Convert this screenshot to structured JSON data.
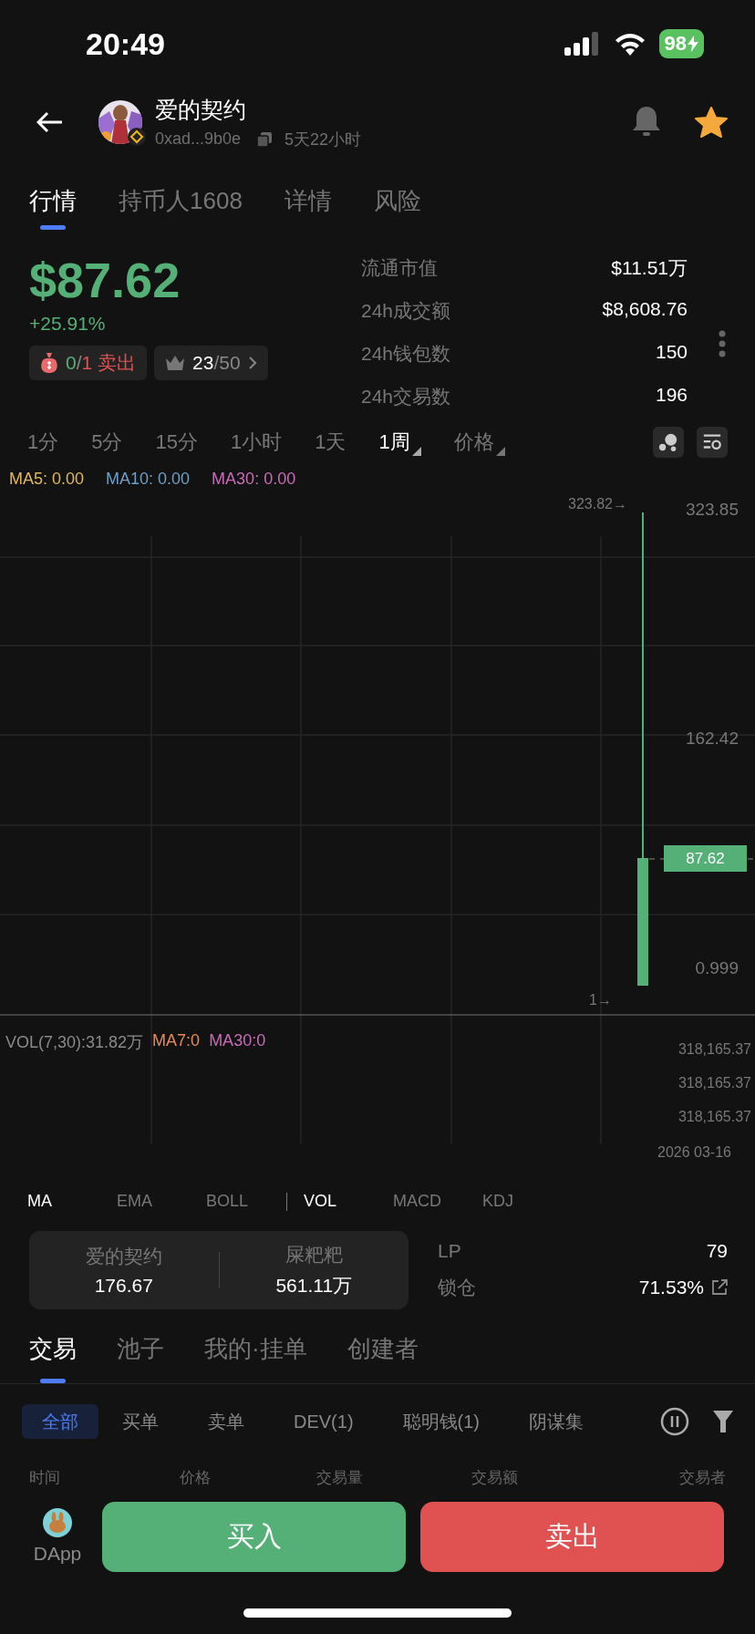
{
  "status_bar": {
    "time": "20:49",
    "battery": "98"
  },
  "header": {
    "title": "爱的契约",
    "address": "0xad...9b0e",
    "age": "5天22小时",
    "starred": true
  },
  "tabs": [
    {
      "label": "行情",
      "selected": true
    },
    {
      "label": "持币人1608",
      "selected": false
    },
    {
      "label": "详情",
      "selected": false
    },
    {
      "label": "风险",
      "selected": false
    }
  ],
  "price": {
    "value": "$87.62",
    "change": "+25.91%"
  },
  "sell_badge": {
    "buys": "0",
    "sep": "/",
    "sells": "1",
    "label": "卖出"
  },
  "top_badge": {
    "rank": "23",
    "total": "/50"
  },
  "stats": [
    {
      "label": "流通市值",
      "value": "$11.51万"
    },
    {
      "label": "24h成交额",
      "value": "$8,608.76"
    },
    {
      "label": "24h钱包数",
      "value": "150"
    },
    {
      "label": "24h交易数",
      "value": "196"
    }
  ],
  "intervals": [
    {
      "label": "1分",
      "selected": false,
      "dropdown": false
    },
    {
      "label": "5分",
      "selected": false,
      "dropdown": false
    },
    {
      "label": "15分",
      "selected": false,
      "dropdown": false
    },
    {
      "label": "1小时",
      "selected": false,
      "dropdown": false
    },
    {
      "label": "1天",
      "selected": false,
      "dropdown": false
    },
    {
      "label": "1周",
      "selected": true,
      "dropdown": true
    },
    {
      "label": "价格",
      "selected": false,
      "dropdown": true
    }
  ],
  "ma_legend": [
    {
      "label": "MA5: 0.00",
      "color": "#e0b85a"
    },
    {
      "label": "MA10: 0.00",
      "color": "#6e9fc8"
    },
    {
      "label": "MA30: 0.00",
      "color": "#c86bb8"
    }
  ],
  "chart": {
    "high_marker": "323.82→",
    "low_marker": "1→",
    "price_labels": [
      "323.85",
      "162.42",
      "0.999"
    ],
    "current_price": "87.62",
    "vol_legend": [
      {
        "label": "VOL(7,30):31.82万",
        "color": "#8a8a8a"
      },
      {
        "label": "MA7:0",
        "color": "#e88a5a"
      },
      {
        "label": "MA30:0",
        "color": "#c86bb8"
      }
    ],
    "vol_labels": [
      "318,165.37",
      "318,165.37",
      "318,165.37"
    ],
    "date": "2026 03-16"
  },
  "indicators_main": [
    {
      "label": "MA",
      "selected": true
    },
    {
      "label": "EMA",
      "selected": false
    },
    {
      "label": "BOLL",
      "selected": false
    }
  ],
  "indicators_sub": [
    {
      "label": "VOL",
      "selected": true
    },
    {
      "label": "MACD",
      "selected": false
    },
    {
      "label": "KDJ",
      "selected": false
    }
  ],
  "pair": [
    {
      "name": "爱的契约",
      "amount": "176.67"
    },
    {
      "name": "屎粑粑",
      "amount": "561.11万"
    }
  ],
  "pool_stats": [
    {
      "label": "LP",
      "value": "79",
      "link": false
    },
    {
      "label": "锁仓",
      "value": "71.53%",
      "link": true
    }
  ],
  "section_tabs": [
    {
      "label": "交易",
      "selected": true
    },
    {
      "label": "池子",
      "selected": false
    },
    {
      "label": "我的·挂单",
      "selected": false
    },
    {
      "label": "创建者",
      "selected": false
    }
  ],
  "filters": [
    {
      "label": "全部",
      "selected": true
    },
    {
      "label": "买单",
      "selected": false
    },
    {
      "label": "卖单",
      "selected": false
    },
    {
      "label": "DEV(1)",
      "selected": false
    },
    {
      "label": "聪明钱(1)",
      "selected": false
    },
    {
      "label": "阴谋集",
      "selected": false
    }
  ],
  "table_columns": [
    "时间",
    "价格",
    "交易量",
    "交易额",
    "交易者"
  ],
  "bottom_bar": {
    "dapp": "DApp",
    "buy": "买入",
    "sell": "卖出"
  }
}
